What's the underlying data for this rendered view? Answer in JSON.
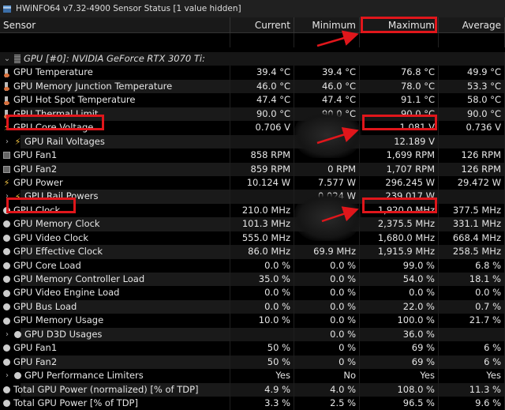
{
  "window": {
    "title": "HWiNFO64 v7.32-4900 Sensor Status [1 value hidden]"
  },
  "columns": [
    "Sensor",
    "Current",
    "Minimum",
    "Maximum",
    "Average"
  ],
  "group": "GPU [#0]: NVIDIA GeForce RTX 3070 Ti:",
  "rows": [
    {
      "icon": "thermometer",
      "name": "GPU Temperature",
      "cur": "39.4 °C",
      "min": "39.4 °C",
      "max": "76.8 °C",
      "avg": "49.9 °C"
    },
    {
      "icon": "thermometer",
      "name": "GPU Memory Junction Temperature",
      "cur": "46.0 °C",
      "min": "46.0 °C",
      "max": "78.0 °C",
      "avg": "53.3 °C"
    },
    {
      "icon": "thermometer",
      "name": "GPU Hot Spot Temperature",
      "cur": "47.4 °C",
      "min": "47.4 °C",
      "max": "91.1 °C",
      "avg": "58.0 °C"
    },
    {
      "icon": "thermometer",
      "name": "GPU Thermal Limit",
      "cur": "90.0 °C",
      "min": "90.0 °C",
      "max": "90.0 °C",
      "avg": "90.0 °C"
    },
    {
      "icon": "lightning",
      "name": "GPU Core Voltage",
      "cur": "0.706 V",
      "min": "",
      "max": "1.081 V",
      "avg": "0.736 V"
    },
    {
      "icon": "lightning",
      "expand": true,
      "name": "GPU Rail Voltages",
      "cur": "",
      "min": "",
      "max": "12.189 V",
      "avg": ""
    },
    {
      "icon": "fan",
      "name": "GPU Fan1",
      "cur": "858 RPM",
      "min": "",
      "max": "1,699 RPM",
      "avg": "126 RPM"
    },
    {
      "icon": "fan",
      "name": "GPU Fan2",
      "cur": "859 RPM",
      "min": "0 RPM",
      "max": "1,707 RPM",
      "avg": "126 RPM"
    },
    {
      "icon": "lightning",
      "name": "GPU Power",
      "cur": "10.124 W",
      "min": "7.577 W",
      "max": "296.245 W",
      "avg": "29.472 W"
    },
    {
      "icon": "lightning",
      "expand": true,
      "name": "GPU Rail Powers",
      "cur": "",
      "min": "0.024 W",
      "max": "239.017 W",
      "avg": ""
    },
    {
      "icon": "circle",
      "name": "GPU Clock",
      "cur": "210.0 MHz",
      "min": "",
      "max": "1,920.0 MHz",
      "avg": "377.5 MHz"
    },
    {
      "icon": "circle",
      "name": "GPU Memory Clock",
      "cur": "101.3 MHz",
      "min": "",
      "max": "2,375.5 MHz",
      "avg": "331.1 MHz"
    },
    {
      "icon": "circle",
      "name": "GPU Video Clock",
      "cur": "555.0 MHz",
      "min": "",
      "max": "1,680.0 MHz",
      "avg": "668.4 MHz"
    },
    {
      "icon": "circle",
      "name": "GPU Effective Clock",
      "cur": "86.0 MHz",
      "min": "69.9 MHz",
      "max": "1,915.9 MHz",
      "avg": "258.5 MHz"
    },
    {
      "icon": "circle",
      "name": "GPU Core Load",
      "cur": "0.0 %",
      "min": "0.0 %",
      "max": "99.0 %",
      "avg": "6.8 %"
    },
    {
      "icon": "circle",
      "name": "GPU Memory Controller Load",
      "cur": "35.0 %",
      "min": "0.0 %",
      "max": "54.0 %",
      "avg": "18.1 %"
    },
    {
      "icon": "circle",
      "name": "GPU Video Engine Load",
      "cur": "0.0 %",
      "min": "0.0 %",
      "max": "0.0 %",
      "avg": "0.0 %"
    },
    {
      "icon": "circle",
      "name": "GPU Bus Load",
      "cur": "0.0 %",
      "min": "0.0 %",
      "max": "22.0 %",
      "avg": "0.7 %"
    },
    {
      "icon": "circle",
      "name": "GPU Memory Usage",
      "cur": "10.0 %",
      "min": "0.0 %",
      "max": "100.0 %",
      "avg": "21.7 %"
    },
    {
      "icon": "circle",
      "expand": true,
      "name": "GPU D3D Usages",
      "cur": "",
      "min": "0.0 %",
      "max": "36.0 %",
      "avg": ""
    },
    {
      "icon": "circle",
      "name": "GPU Fan1",
      "cur": "50 %",
      "min": "0 %",
      "max": "69 %",
      "avg": "6 %"
    },
    {
      "icon": "circle",
      "name": "GPU Fan2",
      "cur": "50 %",
      "min": "0 %",
      "max": "69 %",
      "avg": "6 %"
    },
    {
      "icon": "circle",
      "expand": true,
      "name": "GPU Performance Limiters",
      "cur": "Yes",
      "min": "No",
      "max": "Yes",
      "avg": "Yes"
    },
    {
      "icon": "circle",
      "name": "Total GPU Power (normalized) [% of TDP]",
      "cur": "4.9 %",
      "min": "4.0 %",
      "max": "108.0 %",
      "avg": "11.3 %"
    },
    {
      "icon": "circle",
      "name": "Total GPU Power [% of TDP]",
      "cur": "3.3 %",
      "min": "2.5 %",
      "max": "96.5 %",
      "avg": "9.6 %"
    }
  ],
  "colors": {
    "annotation": "#e0161b",
    "bolt": "#f5c542"
  }
}
